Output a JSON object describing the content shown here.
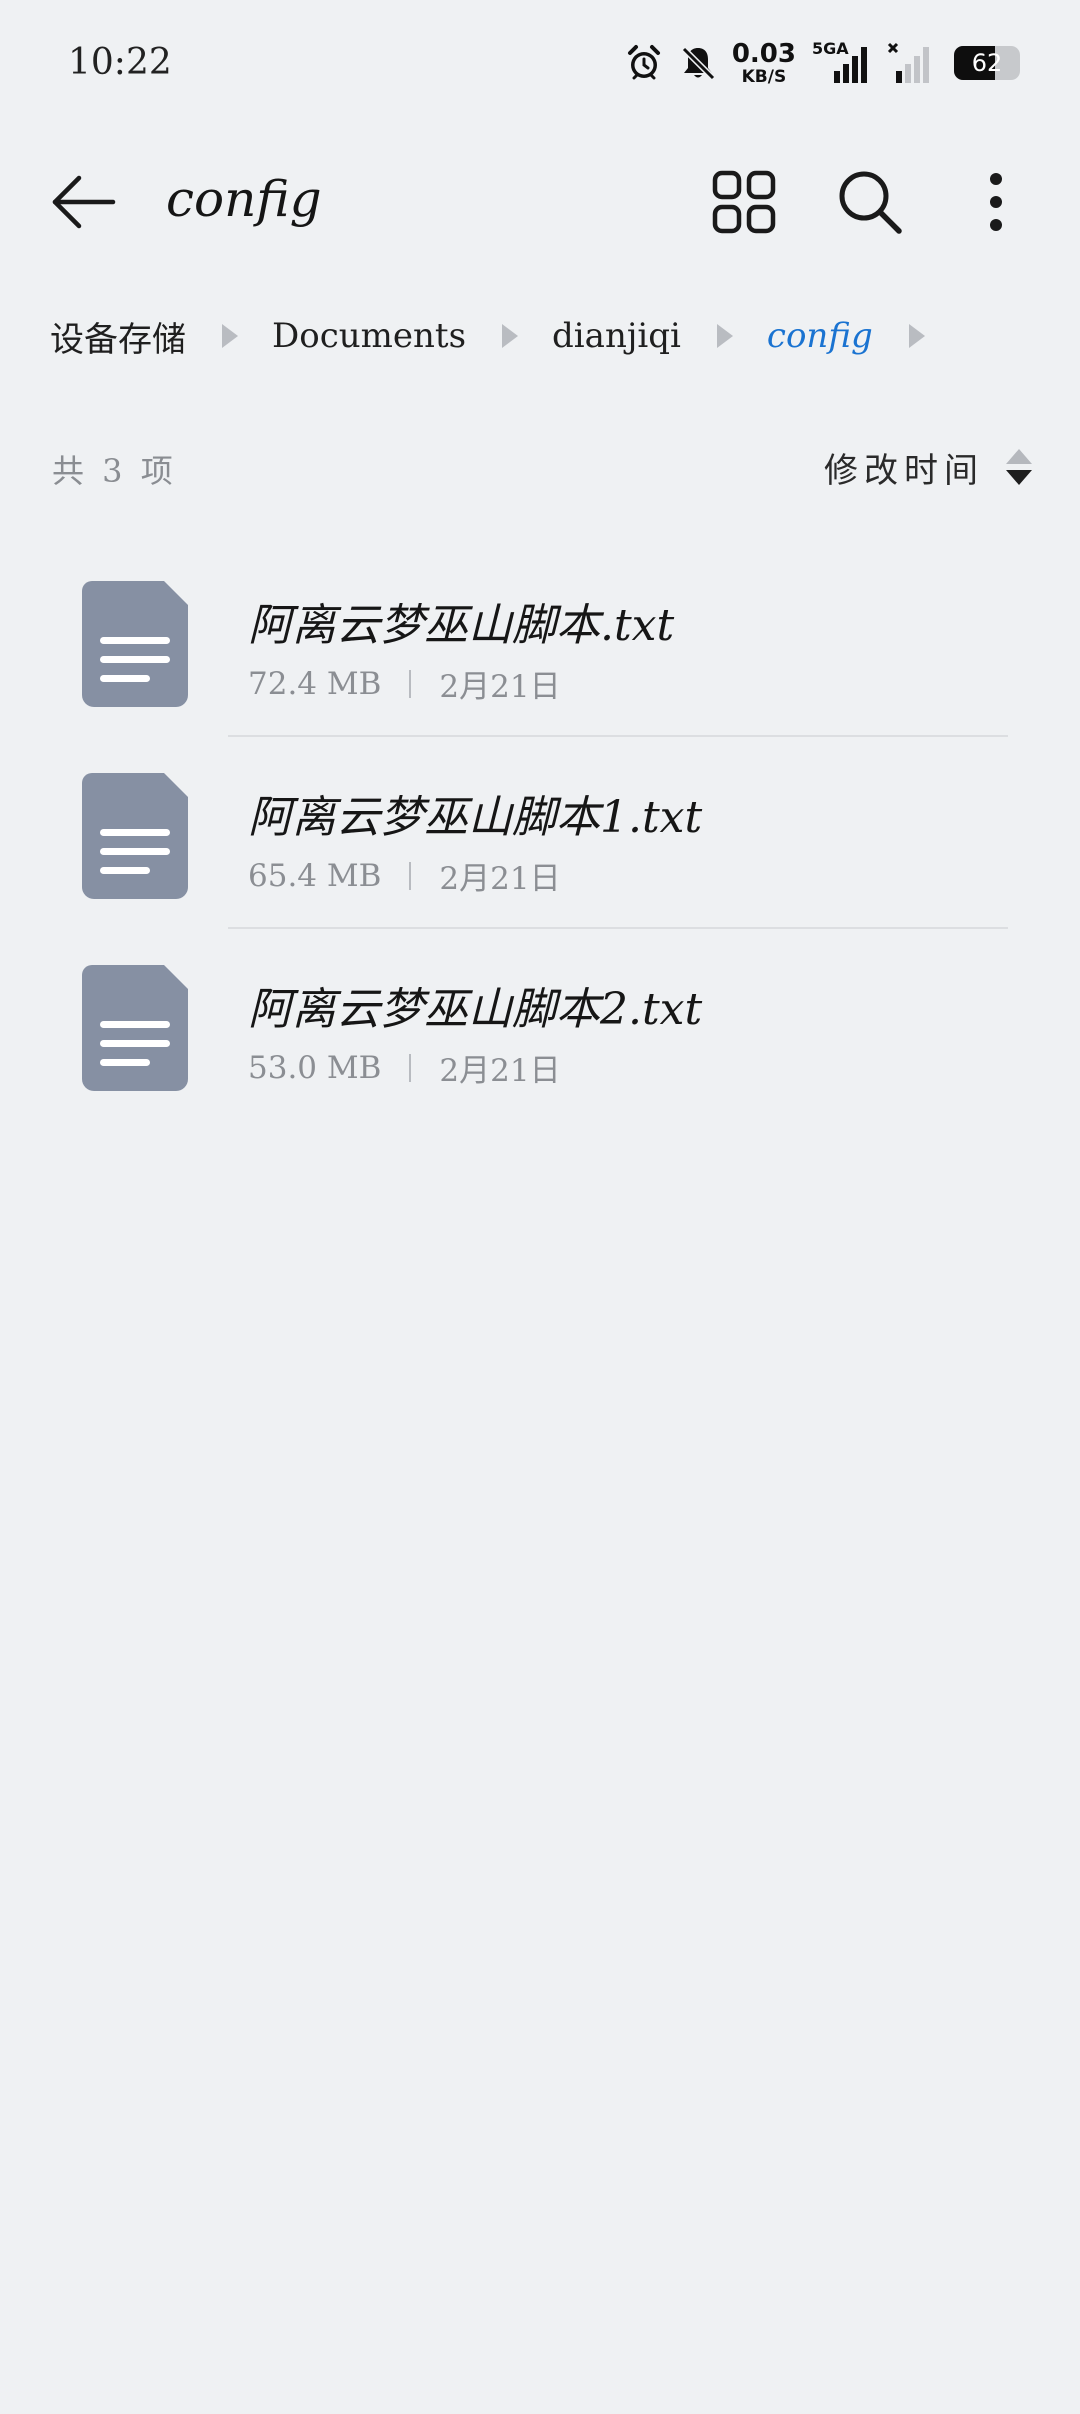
{
  "status_bar": {
    "time": "10:22",
    "net_speed_value": "0.03",
    "net_speed_unit": "KB/S",
    "network_type": "5GA",
    "battery_level": "62",
    "icons": [
      "alarm-icon",
      "bell-off-icon",
      "signal-icon",
      "signal-weak-icon",
      "battery-icon"
    ]
  },
  "header": {
    "title": "config",
    "icons": [
      "back-arrow-icon",
      "grid-view-icon",
      "search-icon",
      "more-vert-icon"
    ]
  },
  "breadcrumb": {
    "items": [
      {
        "label": "设备存储"
      },
      {
        "label": "Documents"
      },
      {
        "label": "dianjiqi"
      },
      {
        "label": "config"
      }
    ]
  },
  "list_header": {
    "item_count": "共 3 项",
    "sort_label": "修改时间"
  },
  "files": [
    {
      "name": "阿离云梦巫山脚本.txt",
      "size": "72.4 MB",
      "date": "2月21日"
    },
    {
      "name": "阿离云梦巫山脚本1.txt",
      "size": "65.4 MB",
      "date": "2月21日"
    },
    {
      "name": "阿离云梦巫山脚本2.txt",
      "size": "53.0 MB",
      "date": "2月21日"
    }
  ],
  "colors": {
    "background": "#eff1f3",
    "accent": "#1a73d1",
    "file_icon": "#8690a3"
  }
}
